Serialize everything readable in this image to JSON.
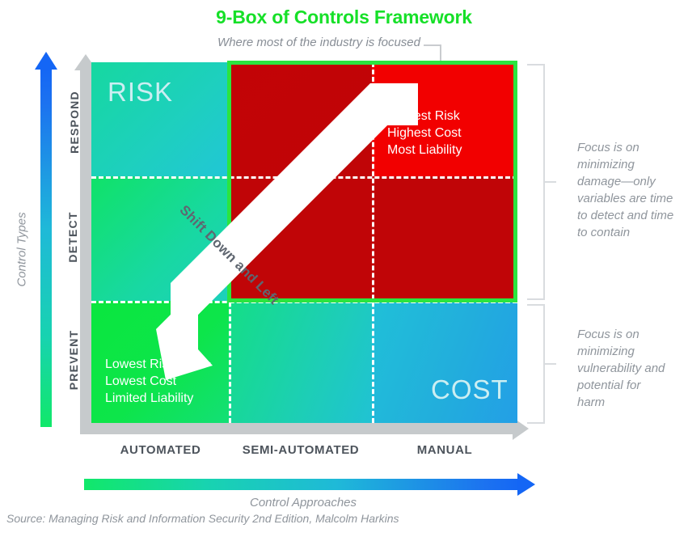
{
  "title": "9-Box of Controls Framework",
  "callout": {
    "text": "Where most of the industry is focused"
  },
  "axes": {
    "y_title": "Control Types",
    "x_title": "Control Approaches",
    "y_ticks": [
      "RESPOND",
      "DETECT",
      "PREVENT"
    ],
    "x_ticks": [
      "AUTOMATED",
      "SEMI-AUTOMATED",
      "MANUAL"
    ]
  },
  "matrix": {
    "corner_labels": {
      "top_left": "RISK",
      "bottom_right": "COST"
    },
    "blocks": {
      "top_right": "Highest Risk\nHighest Cost\nMost Liability",
      "bottom_left": "Lowest Risk\nLowest Cost\nLimited Liability"
    },
    "arrow_label": "Shift Down and Left"
  },
  "notes": [
    {
      "id": "respond-detect-note",
      "text": "Focus is on\nminimizing\ndamage—only\nvariables are time\nto detect and time\nto contain"
    },
    {
      "id": "prevent-note",
      "text": "Focus is on\nminimizing\nvulnerability and\npotential for\nharm"
    }
  ],
  "source": "Source: Managing Risk and Information Security 2nd Edition, Malcolm Harkins",
  "colors": {
    "title_green": "#16E028",
    "outline_green": "#2BE53F",
    "bright_red": "#F20000",
    "dark_red": "#C00507",
    "teal": "#19D4A8",
    "green": "#0DE54A",
    "blue": "#22A8E0",
    "axis_gray": "#C6CACC",
    "note_gray": "#8F959C"
  },
  "chart_data": {
    "type": "heatmap",
    "title": "9-Box of Controls Framework",
    "xlabel": "Control Approaches",
    "ylabel": "Control Types",
    "x_categories": [
      "AUTOMATED",
      "SEMI-AUTOMATED",
      "MANUAL"
    ],
    "y_categories": [
      "RESPOND",
      "DETECT",
      "PREVENT"
    ],
    "cells": [
      {
        "row": "RESPOND",
        "col": "AUTOMATED",
        "fill": "#1FC9BE",
        "highlighted": false,
        "label": "RISK"
      },
      {
        "row": "RESPOND",
        "col": "SEMI-AUTOMATED",
        "fill": "#C00507",
        "highlighted": true,
        "label": ""
      },
      {
        "row": "RESPOND",
        "col": "MANUAL",
        "fill": "#F20000",
        "highlighted": true,
        "label": "Highest Risk / Highest Cost / Most Liability"
      },
      {
        "row": "DETECT",
        "col": "AUTOMATED",
        "fill": "#17D9A0",
        "highlighted": false,
        "label": ""
      },
      {
        "row": "DETECT",
        "col": "SEMI-AUTOMATED",
        "fill": "#C00507",
        "highlighted": true,
        "label": ""
      },
      {
        "row": "DETECT",
        "col": "MANUAL",
        "fill": "#C00507",
        "highlighted": true,
        "label": ""
      },
      {
        "row": "PREVENT",
        "col": "AUTOMATED",
        "fill": "#0DE54A",
        "highlighted": false,
        "label": "Lowest Risk / Lowest Cost / Limited Liability"
      },
      {
        "row": "PREVENT",
        "col": "SEMI-AUTOMATED",
        "fill": "#1DCEA8",
        "highlighted": false,
        "label": ""
      },
      {
        "row": "PREVENT",
        "col": "MANUAL",
        "fill": "#22A8E0",
        "highlighted": false,
        "label": "COST"
      }
    ],
    "annotations": [
      "Where most of the industry is focused",
      "Shift Down and Left",
      "Focus is on minimizing damage—only variables are time to detect and time to contain",
      "Focus is on minimizing vulnerability and potential for harm"
    ],
    "grid": true,
    "legend": "none"
  }
}
